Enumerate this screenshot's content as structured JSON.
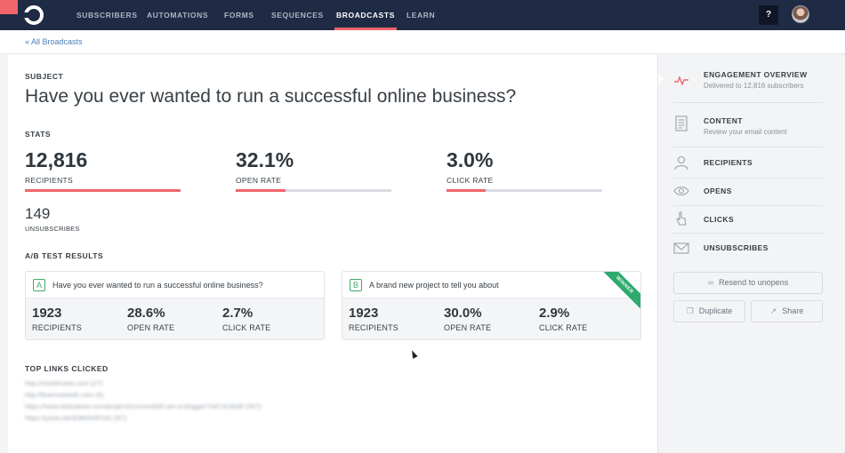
{
  "nav": {
    "items": [
      "SUBSCRIBERS",
      "AUTOMATIONS",
      "FORMS",
      "SEQUENCES",
      "BROADCASTS",
      "LEARN"
    ],
    "active": "BROADCASTS",
    "help_label": "?"
  },
  "breadcrumb": "« All Broadcasts",
  "subject": {
    "label": "SUBJECT",
    "text": "Have you ever wanted to run a successful online business?"
  },
  "stats": {
    "label": "STATS",
    "recipients": {
      "value": "12,816",
      "label": "RECIPIENTS",
      "fill": 1.0
    },
    "open_rate": {
      "value": "32.1%",
      "label": "OPEN RATE",
      "fill": 0.321
    },
    "click_rate": {
      "value": "3.0%",
      "label": "CLICK RATE",
      "fill": 0.25
    },
    "unsubscribes": {
      "value": "149",
      "label": "UNSUBSCRIBES"
    }
  },
  "ab_test": {
    "label": "A/B TEST RESULTS",
    "variants": [
      {
        "letter": "A",
        "subject": "Have you ever wanted to run a successful online business?",
        "recipients": "1923",
        "recipients_label": "RECIPIENTS",
        "open_rate": "28.6%",
        "open_rate_label": "OPEN RATE",
        "click_rate": "2.7%",
        "click_rate_label": "CLICK RATE"
      },
      {
        "letter": "B",
        "subject": "A brand new project to tell you about",
        "recipients": "1923",
        "recipients_label": "RECIPIENTS",
        "open_rate": "30.0%",
        "open_rate_label": "OPEN RATE",
        "click_rate": "2.9%",
        "click_rate_label": "CLICK RATE",
        "badge": "WINNER"
      }
    ]
  },
  "top_links": {
    "label": "TOP LINKS CLICKED",
    "items": [
      "http://charlimarie.com (27)",
      "http://linernotekids.com (6)",
      "https://www.kickstarter.com/projects/convertkit/i-am-a-blogger?ref=3245d0 (307)",
      "https://youtu.be/dJ8KhHP24U (87)"
    ]
  },
  "sidebar": {
    "items": [
      {
        "title": "ENGAGEMENT OVERVIEW",
        "sub": "Delivered to 12,816 subscribers",
        "icon": "pulse-icon",
        "active": true
      },
      {
        "title": "CONTENT",
        "sub": "Review your email content",
        "icon": "document-icon"
      },
      {
        "title": "RECIPIENTS",
        "icon": "users-icon"
      },
      {
        "title": "OPENS",
        "icon": "eye-icon"
      },
      {
        "title": "CLICKS",
        "icon": "hand-pointer-icon"
      },
      {
        "title": "UNSUBSCRIBES",
        "icon": "envelope-icon"
      }
    ],
    "resend_label": "Resend to unopens",
    "duplicate_label": "Duplicate",
    "share_label": "Share"
  },
  "colors": {
    "nav_bg": "#1f2a44",
    "accent": "#f0666b",
    "winner": "#2eaa6e",
    "link": "#4a7fb6"
  }
}
